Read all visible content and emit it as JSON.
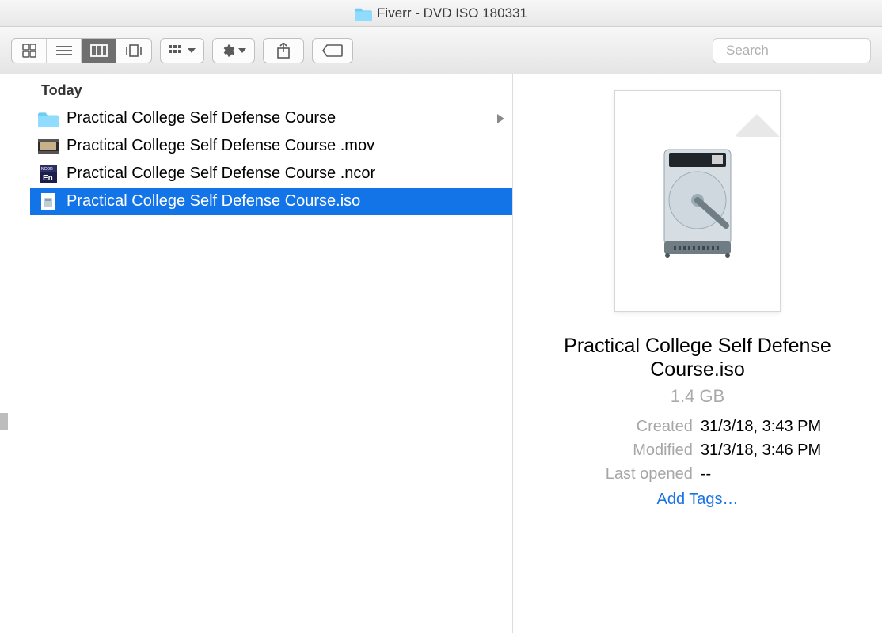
{
  "window": {
    "title": "Fiverr - DVD ISO 180331"
  },
  "toolbar": {
    "view_mode": "columns",
    "group_dropdown_label": "",
    "action_dropdown_label": "",
    "share_label": "",
    "tags_label": ""
  },
  "search": {
    "placeholder": "Search",
    "value": ""
  },
  "column": {
    "header": "Today",
    "items": [
      {
        "name": "Practical College Self Defense Course",
        "kind": "folder",
        "has_children": true,
        "selected": false
      },
      {
        "name": "Practical College Self Defense Course .mov",
        "kind": "movie",
        "has_children": false,
        "selected": false
      },
      {
        "name": "Practical College Self Defense Course .ncor",
        "kind": "encore",
        "has_children": false,
        "selected": false
      },
      {
        "name": "Practical College Self Defense Course.iso",
        "kind": "iso",
        "has_children": false,
        "selected": true
      }
    ]
  },
  "preview": {
    "file_name": "Practical College Self Defense Course.iso",
    "size": "1.4 GB",
    "created_label": "Created",
    "created_value": "31/3/18, 3:43 PM",
    "modified_label": "Modified",
    "modified_value": "31/3/18, 3:46 PM",
    "last_opened_label": "Last opened",
    "last_opened_value": "--",
    "add_tags_label": "Add Tags…"
  }
}
